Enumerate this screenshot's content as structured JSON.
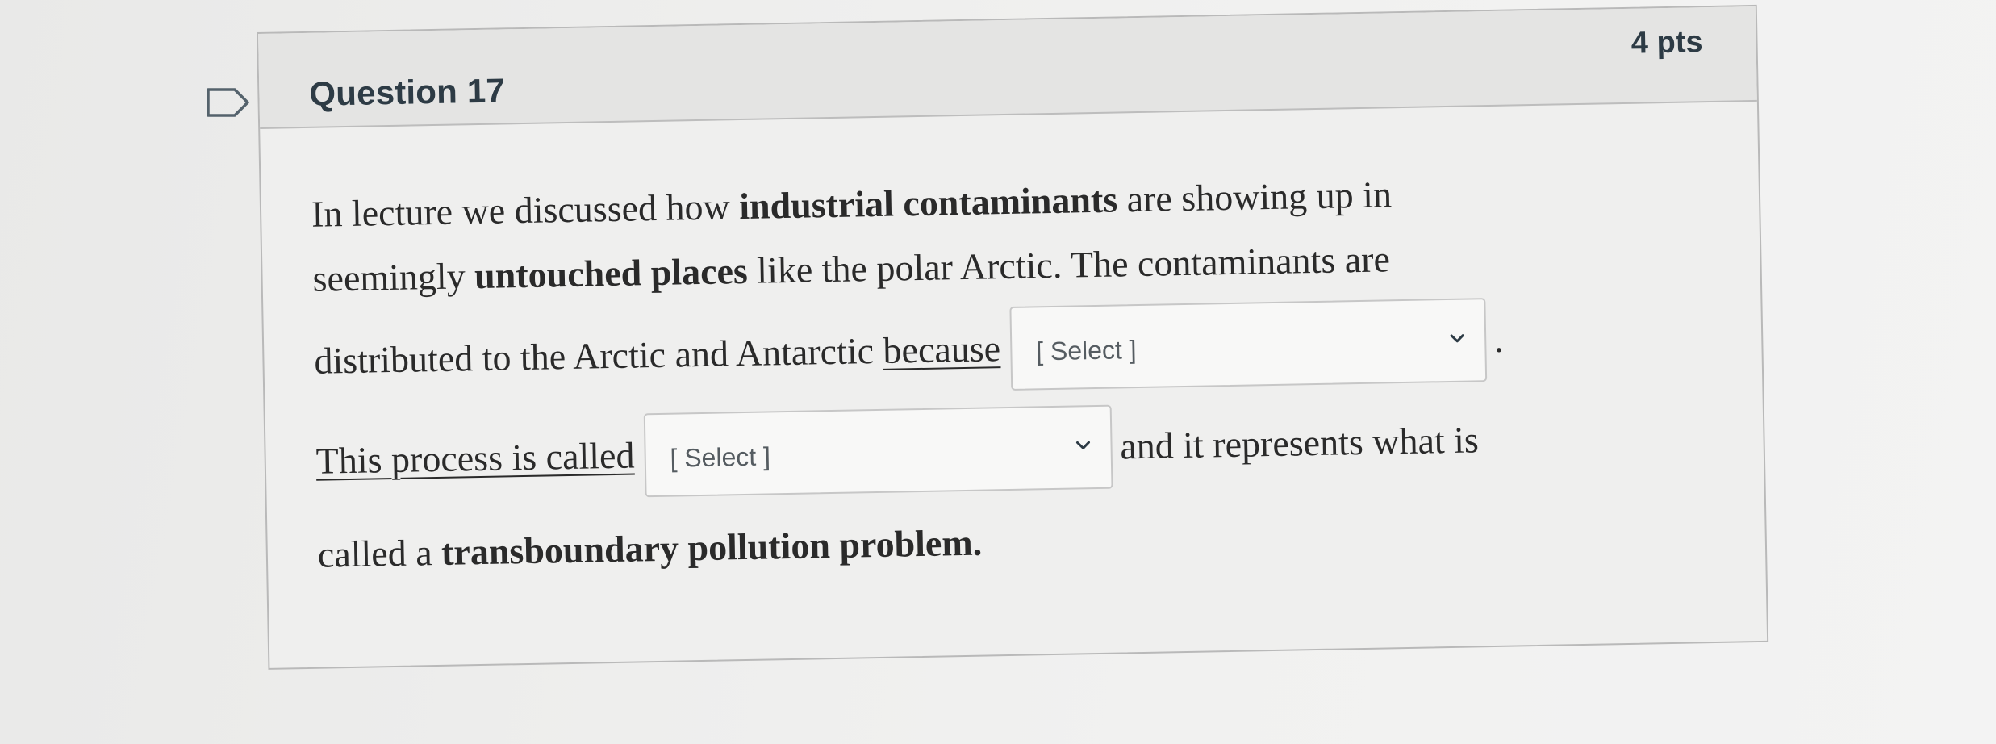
{
  "question": {
    "title": "Question 17",
    "points": "4 pts",
    "flag_icon": "flag-outline-icon"
  },
  "body": {
    "line1_a": "In lecture we discussed how ",
    "line1_b": "industrial contaminants",
    "line1_c": " are showing up in",
    "line2_a": "seemingly ",
    "line2_b": "untouched places",
    "line2_c": " like the polar Arctic. The contaminants are",
    "line3_a": "distributed to the Arctic and Antarctic ",
    "line3_b": "because",
    "line3_c": ".",
    "line4_a": "This process is called",
    "line4_b": "and it represents what is",
    "line5_a": "called a ",
    "line5_b": "transboundary pollution problem."
  },
  "dropdowns": {
    "first": {
      "selected": "[ Select ]",
      "icon": "chevron-down-icon"
    },
    "second": {
      "selected": "[ Select ]",
      "icon": "chevron-down-icon"
    }
  },
  "colors": {
    "header_bg": "#e4e4e3",
    "card_bg": "#efefee",
    "title_text": "#2d3b45",
    "border": "#b9b9b9"
  }
}
